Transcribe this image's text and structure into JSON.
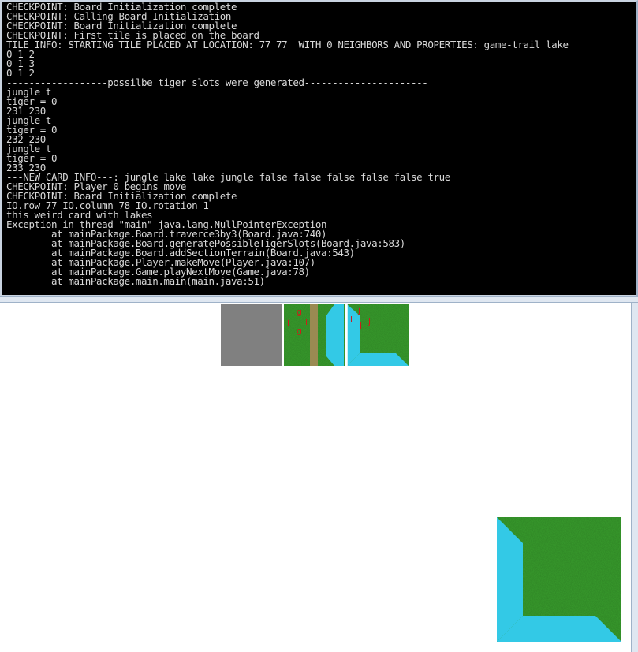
{
  "console": {
    "lines": [
      "CHECKPOINT: Board Initialization complete",
      "CHECKPOINT: Calling Board Initialization",
      "CHECKPOINT: Board Initialization complete",
      "CHECKPOINT: First tile is placed on the board",
      "TILE INFO: STARTING TILE PLACED AT LOCATION: 77 77  WITH 0 NEIGHBORS AND PROPERTIES: game-trail lake",
      "0 1 2",
      "0 1 3",
      "0 1 2",
      "------------------possilbe tiger slots were generated----------------------",
      "jungle t",
      "tiger = 0",
      "231 230",
      "jungle t",
      "tiger = 0",
      "232 230",
      "jungle t",
      "tiger = 0",
      "233 230",
      "---NEW CARD INFO---: jungle lake lake jungle false false false false false true",
      "CHECKPOINT: Player 0 begins move",
      "CHECKPOINT: Board Initialization complete",
      "IO.row 77 IO.column 78 IO.rotation 1",
      "this weird card with lakes",
      "Exception in thread \"main\" java.lang.NullPointerException",
      "        at mainPackage.Board.traverce3by3(Board.java:740)",
      "        at mainPackage.Board.generatePossibleTigerSlots(Board.java:583)",
      "        at mainPackage.Board.addSectionTerrain(Board.java:543)",
      "        at mainPackage.Player.makeMove(Player.java:107)",
      "        at mainPackage.Game.playNextMove(Game.java:78)",
      "        at mainPackage.main.main(main.java:51)"
    ]
  },
  "board": {
    "tiles": [
      {
        "name": "empty-slot-tile",
        "kind": "empty"
      },
      {
        "name": "game-trail-tile",
        "kind": "trail-lake",
        "labels": [
          "g",
          "j",
          "l",
          "g"
        ]
      },
      {
        "name": "lake-corner-tile",
        "kind": "lake-corner",
        "labels": [
          "j",
          "l",
          "j",
          "l"
        ]
      }
    ],
    "preview": {
      "name": "current-card-preview",
      "kind": "lake-corner-large"
    }
  },
  "colors": {
    "console_bg": "#000000",
    "console_text": "#d8d8d8",
    "jungle": "#3aa12e",
    "lake": "#33c9e6",
    "trail": "#9a8a52",
    "empty": "#808080",
    "label": "#d11a1a"
  }
}
